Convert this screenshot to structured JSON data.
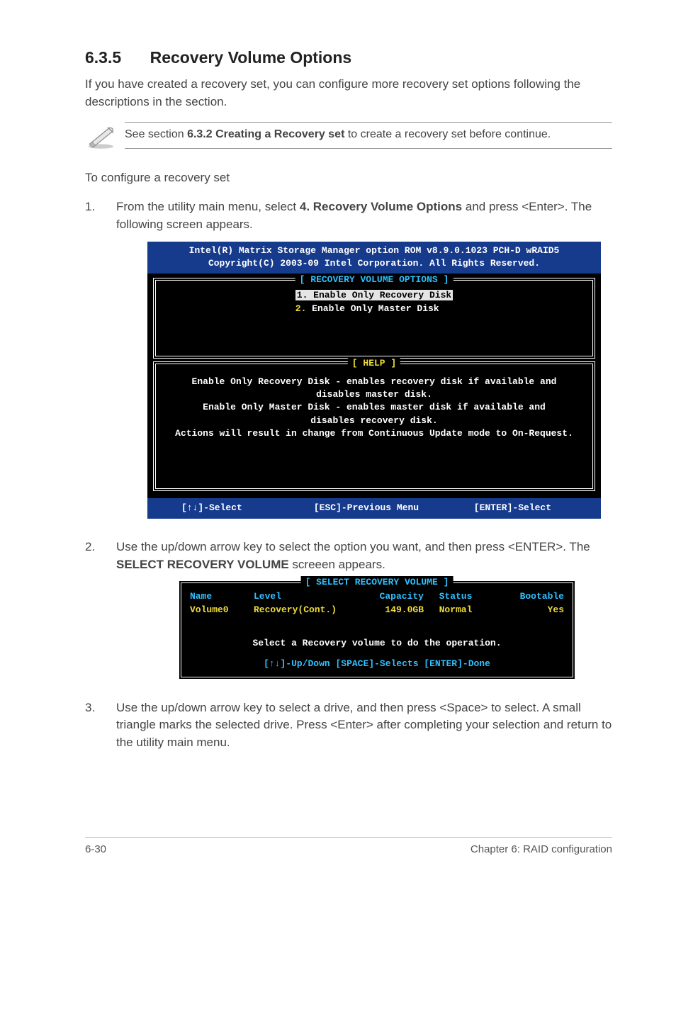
{
  "section": {
    "number": "6.3.5",
    "title": "Recovery Volume Options"
  },
  "intro": "If you have created a recovery set, you can configure more recovery set options following the descriptions in the section.",
  "note": {
    "pre": "See section ",
    "bold": "6.3.2 Creating a Recovery set",
    "post": " to create a recovery set before continue."
  },
  "configure_line": "To configure a recovery set",
  "steps": {
    "s1": {
      "num": "1.",
      "pre": "From the utility main menu, select ",
      "bold": "4. Recovery Volume Options",
      "post": " and press <Enter>. The following screen appears."
    },
    "s2": {
      "num": "2.",
      "pre": "Use the up/down arrow key to select the option you want, and then press <ENTER>. The ",
      "bold": "SELECT RECOVERY VOLUME",
      "post": " screeen appears."
    },
    "s3": {
      "num": "3.",
      "text": "Use the up/down arrow key to select a drive, and then press <Space> to select. A small triangle marks the selected drive. Press <Enter> after completing your selection and return to the utility main menu."
    }
  },
  "console1": {
    "header_l1": "Intel(R) Matrix Storage Manager option ROM v8.9.0.1023 PCH-D wRAID5",
    "header_l2": "Copyright(C) 2003-09 Intel Corporation.  All Rights Reserved.",
    "options_legend": "[ RECOVERY VOLUME OPTIONS ]",
    "opt1_num": "1.",
    "opt1_text": "  Enable Only Recovery Disk ",
    "opt2_num": "2.",
    "opt2_text": "  Enable Only Master Disk",
    "help_legend": "[ HELP ]",
    "help_l1": "Enable Only Recovery Disk - enables recovery disk if available and",
    "help_l2": "disables master disk.",
    "help_l3": "Enable Only Master Disk - enables master disk if available and",
    "help_l4": "disables recovery disk.",
    "help_l5": "Actions will result in change from Continuous Update mode to On-Request.",
    "foot_left": "[↑↓]-Select",
    "foot_mid": "[ESC]-Previous Menu",
    "foot_right": "[ENTER]-Select"
  },
  "console2": {
    "legend": "[ SELECT RECOVERY VOLUME ]",
    "hdr_name": "Name",
    "hdr_level": "Level",
    "hdr_cap": "Capacity",
    "hdr_status": "Status",
    "hdr_boot": "Bootable",
    "row_name": "Volume0",
    "row_level": "Recovery(Cont.)",
    "row_cap": "149.0GB",
    "row_status": "Normal",
    "row_boot": "Yes",
    "mid": "Select a Recovery volume to do the operation.",
    "foot": "[↑↓]-Up/Down [SPACE]-Selects [ENTER]-Done"
  },
  "footer": {
    "left": "6-30",
    "right": "Chapter 6: RAID configuration"
  }
}
